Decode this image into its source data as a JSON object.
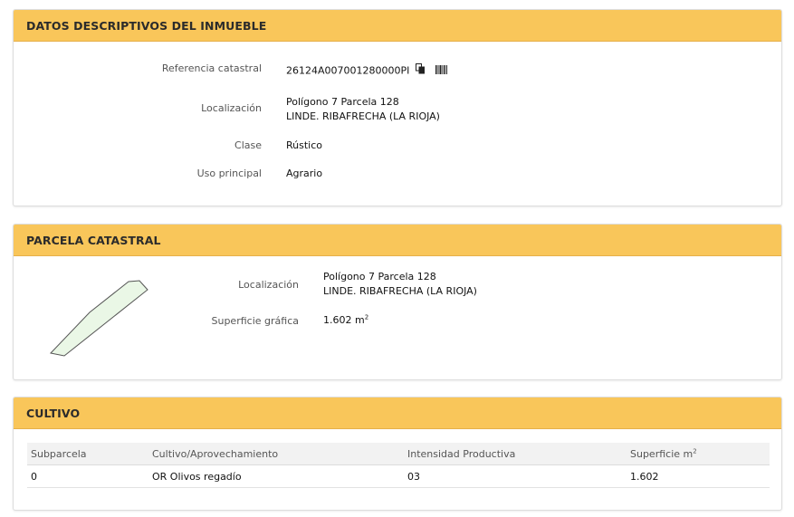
{
  "panel1": {
    "title": "DATOS DESCRIPTIVOS DEL INMUEBLE",
    "ref_label": "Referencia catastral",
    "ref_value": "26124A007001280000PI",
    "loc_label": "Localización",
    "loc_line1": "Polígono 7 Parcela 128",
    "loc_line2": "LINDE. RIBAFRECHA (LA RIOJA)",
    "clase_label": "Clase",
    "clase_value": "Rústico",
    "uso_label": "Uso principal",
    "uso_value": "Agrario"
  },
  "panel2": {
    "title": "PARCELA CATASTRAL",
    "loc_label": "Localización",
    "loc_line1": "Polígono 7 Parcela 128",
    "loc_line2": "LINDE. RIBAFRECHA (LA RIOJA)",
    "sup_label": "Superficie gráfica",
    "sup_value": "1.602 m",
    "sup_exp": "2"
  },
  "panel3": {
    "title": "CULTIVO",
    "headers": {
      "subparcela": "Subparcela",
      "cultivo": "Cultivo/Aprovechamiento",
      "intensidad": "Intensidad Productiva",
      "superficie": "Superficie m",
      "superficie_exp": "2"
    },
    "rows": [
      {
        "subparcela": "0",
        "cultivo": "OR Olivos regadío",
        "intensidad": "03",
        "superficie": "1.602"
      }
    ]
  },
  "colors": {
    "header_bg": "#f9c65a",
    "parcel_fill": "#eaf7e6",
    "parcel_stroke": "#555555"
  },
  "icons": [
    "copy-icon",
    "barcode-icon"
  ]
}
